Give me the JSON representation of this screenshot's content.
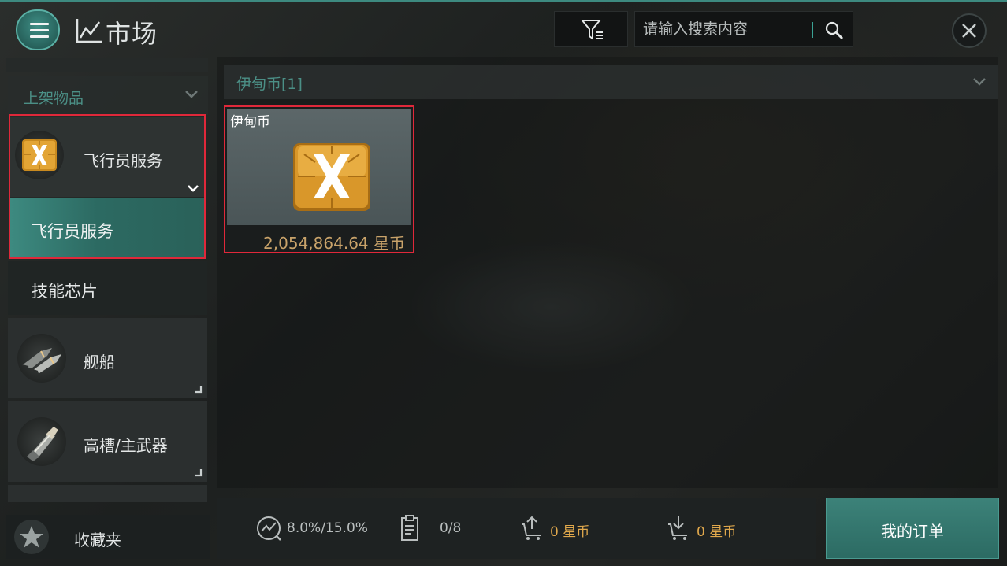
{
  "header": {
    "title": "市场",
    "search_placeholder": "请输入搜索内容"
  },
  "sidebar": {
    "listed_items_label": "上架物品",
    "categories": [
      {
        "label": "飞行员服务",
        "icon": "crystal-x-icon"
      },
      {
        "label": "舰船",
        "icon": "ship-icon"
      },
      {
        "label": "高槽/主武器",
        "icon": "weapon-icon"
      }
    ],
    "subcategories": [
      {
        "label": "飞行员服务",
        "selected": true
      },
      {
        "label": "技能芯片",
        "selected": false
      }
    ],
    "favorites_label": "收藏夹"
  },
  "main": {
    "group_label": "伊甸币[1]",
    "items": [
      {
        "name": "伊甸币",
        "price": "2,054,864.64 星币",
        "icon": "crystal-x-icon"
      }
    ]
  },
  "footer": {
    "tax": "8.0%/15.0%",
    "orders": "0/8",
    "sell_amount": "0 星币",
    "buy_amount": "0 星币",
    "my_orders_label": "我的订单"
  },
  "colors": {
    "accent": "#3d8a80",
    "highlight": "#e0283a",
    "price": "#c9a36a",
    "currency": "#e0a84c"
  }
}
